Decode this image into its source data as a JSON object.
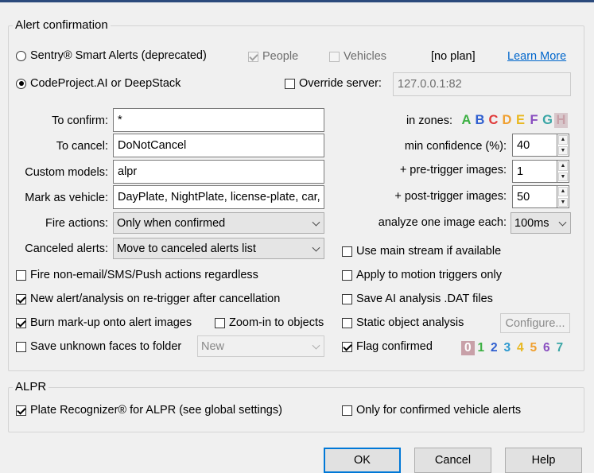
{
  "alert_group": {
    "title": "Alert confirmation",
    "sentry_radio": "Sentry® Smart Alerts (deprecated)",
    "people_label": "People",
    "vehicles_label": "Vehicles",
    "no_plan": "[no plan]",
    "learn_more": "Learn More",
    "codeproject_radio": "CodeProject.AI or DeepStack",
    "override_server_label": "Override server:",
    "override_server_value": "127.0.0.1:82",
    "to_confirm_label": "To confirm:",
    "to_confirm_value": "*",
    "to_cancel_label": "To cancel:",
    "to_cancel_value": "DoNotCancel",
    "custom_models_label": "Custom models:",
    "custom_models_value": "alpr",
    "mark_vehicle_label": "Mark as vehicle:",
    "mark_vehicle_value": "DayPlate, NightPlate, license-plate, car,",
    "fire_actions_label": "Fire actions:",
    "fire_actions_value": "Only when confirmed",
    "canceled_alerts_label": "Canceled alerts:",
    "canceled_alerts_value": "Move to canceled alerts list",
    "in_zones_label": "in zones:",
    "zones": [
      {
        "letter": "A",
        "color": "#3cb043"
      },
      {
        "letter": "B",
        "color": "#2f5fd0"
      },
      {
        "letter": "C",
        "color": "#e03a3a"
      },
      {
        "letter": "D",
        "color": "#f0a030"
      },
      {
        "letter": "E",
        "color": "#e8b820"
      },
      {
        "letter": "F",
        "color": "#8a4fc0"
      },
      {
        "letter": "G",
        "color": "#3aa6a6"
      },
      {
        "letter": "H",
        "color": "#c8a0a8"
      }
    ],
    "min_conf_label": "min confidence (%):",
    "min_conf_value": "40",
    "pre_trigger_label": "+ pre-trigger images:",
    "pre_trigger_value": "1",
    "post_trigger_label": "+ post-trigger images:",
    "post_trigger_value": "50",
    "analyze_label": "analyze one image each:",
    "analyze_value": "100ms",
    "use_main_stream": "Use main stream if available",
    "fire_non_email": "Fire non-email/SMS/Push actions regardless",
    "apply_motion": "Apply to motion triggers only",
    "new_alert": "New alert/analysis on re-trigger after cancellation",
    "save_dat": "Save AI analysis .DAT files",
    "burn_markup": "Burn mark-up onto alert images",
    "zoom_objects": "Zoom-in to objects",
    "static_object": "Static object analysis",
    "configure_button": "Configure...",
    "save_unknown_faces": "Save unknown faces to folder",
    "faces_folder_value": "New",
    "flag_confirmed": "Flag confirmed",
    "flag_numbers": [
      {
        "n": "0",
        "color": "#ffffff",
        "bg": "#c8a0a8"
      },
      {
        "n": "1",
        "color": "#3cb043",
        "bg": ""
      },
      {
        "n": "2",
        "color": "#2f5fd0",
        "bg": ""
      },
      {
        "n": "3",
        "color": "#2f9ad0",
        "bg": ""
      },
      {
        "n": "4",
        "color": "#e8b820",
        "bg": ""
      },
      {
        "n": "5",
        "color": "#f0a030",
        "bg": ""
      },
      {
        "n": "6",
        "color": "#8a4fc0",
        "bg": ""
      },
      {
        "n": "7",
        "color": "#3aa6a6",
        "bg": ""
      }
    ]
  },
  "alpr_group": {
    "title": "ALPR",
    "plate_recognizer": "Plate Recognizer® for ALPR (see global settings)",
    "only_confirmed_vehicle": "Only for confirmed vehicle alerts"
  },
  "buttons": {
    "ok": "OK",
    "cancel": "Cancel",
    "help": "Help"
  }
}
